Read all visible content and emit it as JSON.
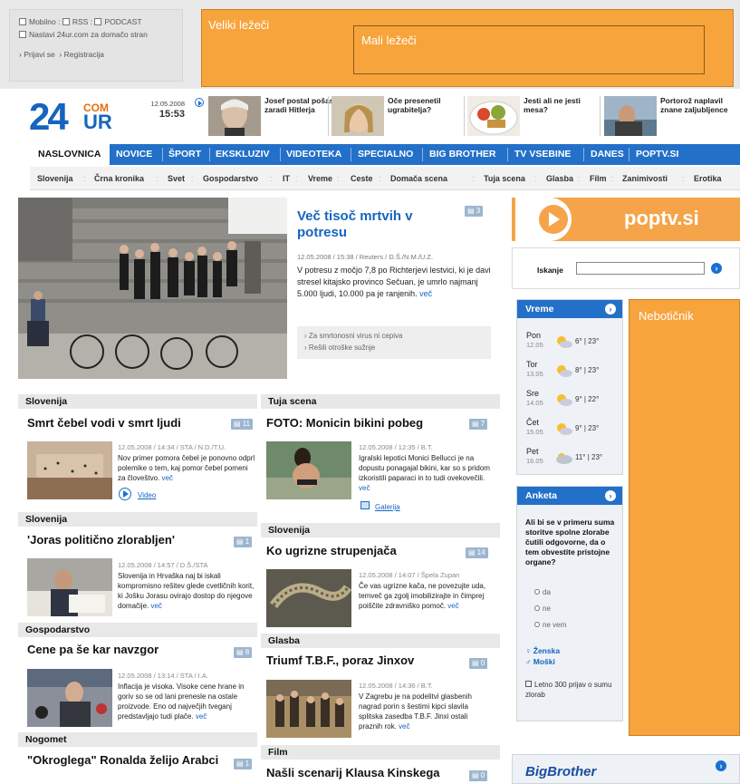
{
  "toplinks": {
    "mobilno": "Mobilno",
    "rss": "RSS",
    "podcast": "PODCAST",
    "nastavi": "Nastavi 24ur.com za domačo stran",
    "prijava": "Prijavi se",
    "registracija": "Registracija"
  },
  "ads": {
    "big": "Veliki ležeči",
    "small": "Mali ležeči",
    "side": "Nebotičnik"
  },
  "logo": {
    "number": "24",
    "com": "COM",
    "ur": "UR"
  },
  "clock": {
    "date": "12.05.2008",
    "time": "15:53"
  },
  "teasers": [
    {
      "text": "Josef postal pošast zaradi Hitlerja"
    },
    {
      "text": "Oče presenetil ugrabitelja?"
    },
    {
      "text": "Jesti ali ne jesti mesa?"
    },
    {
      "text": "Portorož naplavil znane zaljubljence"
    }
  ],
  "nav": [
    "NASLOVNICA",
    "NOVICE",
    "ŠPORT",
    "EKSKLUZIV",
    "VIDEOTEKA",
    "SPECIALNO",
    "BIG BROTHER",
    "TV VSEBINE",
    "DANES",
    "POPTV.SI"
  ],
  "subnav": [
    "Slovenija",
    "Črna kronika",
    "Svet",
    "Gospodarstvo",
    "IT",
    "Vreme",
    "Ceste",
    "Domača scena",
    "Tuja scena",
    "Glasba",
    "Film",
    "Zanimivosti",
    "Erotika"
  ],
  "headline": {
    "title": "Več tisoč mrtvih v potresu",
    "comments": "3",
    "meta": "12.05.2008 / 15:38 / Reuters / D.Š./N.M./U.Z.",
    "body": "V potresu z močjo 7,8 po Richterjevi lestvici, ki je davi stresel kitajsko provinco Sečuan, je umrlo najmanj 5.000 ljudi, 10.000 pa je ranjenih.",
    "more": "več",
    "related": [
      "Za smrtonosni virus ni cepiva",
      "Rešili otroške sužnje"
    ]
  },
  "left_articles": [
    {
      "section": "Slovenija",
      "title": "Smrt čebel vodi v smrt ljudi",
      "comments": "11",
      "meta": "12.05.2008 / 14:34 / STA / N.D./T.U.",
      "text": "Nov primer pomora čebel je ponovno odprl polemike o tem, kaj pomor čebel pomeni za človeštvo.",
      "more": "več",
      "link": "Video"
    },
    {
      "section": "Slovenija",
      "title": "'Joras politično zlorabljen'",
      "comments": "1",
      "meta": "12.05.2008 / 14:57 / D.Š./STA",
      "text": "Slovenija in Hrvaška naj bi iskali kompromisno rešitev glede cvetličnih korit, ki Jošku Jorasu ovirajo dostop do njegove domačije.",
      "more": "več"
    },
    {
      "section": "Gospodarstvo",
      "title": "Cene pa še kar navzgor",
      "comments": "8",
      "meta": "12.05.2008 / 13:14 / STA / I.A.",
      "text": "Inflacija je visoka. Visoke cene hrane in goriv so se od lani prenesle na ostale proizvode. Eno od največjih tveganj predstavljajo tudi plače.",
      "more": "več"
    },
    {
      "section": "Nogomet",
      "title": "\"Okroglega\" Ronalda želijo Arabci",
      "comments": "1"
    }
  ],
  "right_articles": [
    {
      "section": "Tuja scena",
      "title": "FOTO: Monicin bikini pobeg",
      "comments": "7",
      "meta": "12.05.2008 / 12:35 / B.T.",
      "text": "Igralski lepotici Monici Bellucci je na dopustu ponagajal bikini, kar so s pridom izkoristili paparaci in to tudi ovekovečili.",
      "more": "več",
      "link": "Galerija"
    },
    {
      "section": "Slovenija",
      "title": "Ko ugrizne strupenjača",
      "comments": "14",
      "meta": "12.05.2008 / 14:07 / Špela Zupan",
      "text": "Če vas ugrizne kača, ne povezujte uda, temveč ga zgolj imobilizirajte in čimprej poiščite zdravniško pomoč.",
      "more": "več"
    },
    {
      "section": "Glasba",
      "title": "Triumf T.B.F., poraz Jinxov",
      "comments": "0",
      "meta": "12.05.2008 / 14:36 / B.T.",
      "text": "V Zagrebu je na podelitvi glasbenih nagrad porin s šestimi kipci slavila splitska zasedba T.B.F. Jinxi ostali praznih rok.",
      "more": "več"
    },
    {
      "section": "Film",
      "title": "Našli scenarij Klausa Kinskega",
      "comments": "0"
    }
  ],
  "poptv": {
    "label": "poptv.si"
  },
  "search": {
    "label": "Iskanje",
    "placeholder": ""
  },
  "weather": {
    "title": "Vreme",
    "days": [
      {
        "day": "Pon",
        "date": "12.05",
        "temp": "6° | 23°"
      },
      {
        "day": "Tor",
        "date": "13.05",
        "temp": "8° | 23°"
      },
      {
        "day": "Sre",
        "date": "14.05",
        "temp": "9° | 22°"
      },
      {
        "day": "Čet",
        "date": "15.05",
        "temp": "9° | 23°"
      },
      {
        "day": "Pet",
        "date": "16.05",
        "temp": "11° | 23°"
      }
    ]
  },
  "poll": {
    "title": "Anketa",
    "question": "Ali bi se v primeru suma storitve spolne zlorabe čutili odgovorne, da o tem obvestite pristojne organe?",
    "options": [
      "da",
      "ne",
      "ne vem"
    ],
    "female": "Ženska",
    "male": "Moški",
    "footer": "Letno 300 prijav o sumu zlorab"
  },
  "bigbrother": {
    "label": "BigBrother"
  },
  "colors": {
    "brand_blue": "#2370c9",
    "ad_orange": "#f7a43d",
    "link_blue": "#1565c0"
  }
}
